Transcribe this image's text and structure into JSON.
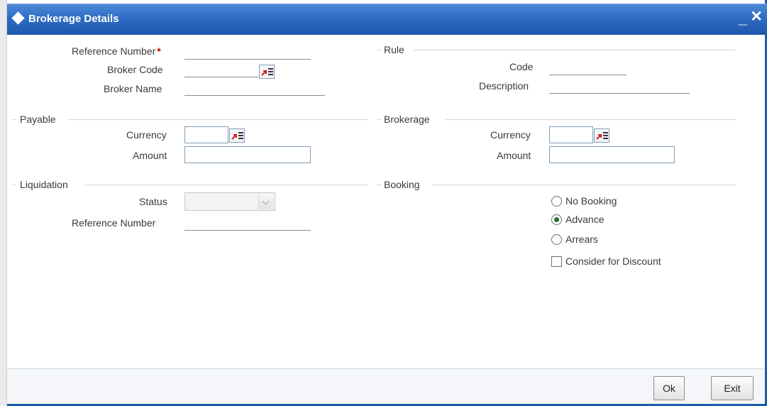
{
  "window": {
    "title": "Brokerage Details",
    "minimize_glyph": "_",
    "close_glyph": "✕"
  },
  "fields": {
    "reference_number": {
      "label": "Reference Number",
      "required_mark": "*",
      "value": ""
    },
    "broker_code": {
      "label": "Broker Code",
      "value": ""
    },
    "broker_name": {
      "label": "Broker Name",
      "value": ""
    }
  },
  "rule": {
    "title": "Rule",
    "code_label": "Code",
    "code_value": "",
    "description_label": "Description",
    "description_value": ""
  },
  "payable": {
    "title": "Payable",
    "currency_label": "Currency",
    "currency_value": "",
    "amount_label": "Amount",
    "amount_value": ""
  },
  "brokerage": {
    "title": "Brokerage",
    "currency_label": "Currency",
    "currency_value": "",
    "amount_label": "Amount",
    "amount_value": ""
  },
  "liquidation": {
    "title": "Liquidation",
    "status_label": "Status",
    "status_value": "",
    "reference_label": "Reference Number",
    "reference_value": ""
  },
  "booking": {
    "title": "Booking",
    "options": [
      {
        "label": "No Booking",
        "checked": false
      },
      {
        "label": "Advance",
        "checked": true
      },
      {
        "label": "Arrears",
        "checked": false
      }
    ],
    "discount_label": "Consider for Discount",
    "discount_checked": false
  },
  "buttons": {
    "ok": "Ok",
    "exit": "Exit"
  },
  "icons": {
    "lov": "list-of-values-icon"
  },
  "colors": {
    "title_bar": "#2e6cc3",
    "required": "#cc0000",
    "frame": "#1c5cab"
  }
}
